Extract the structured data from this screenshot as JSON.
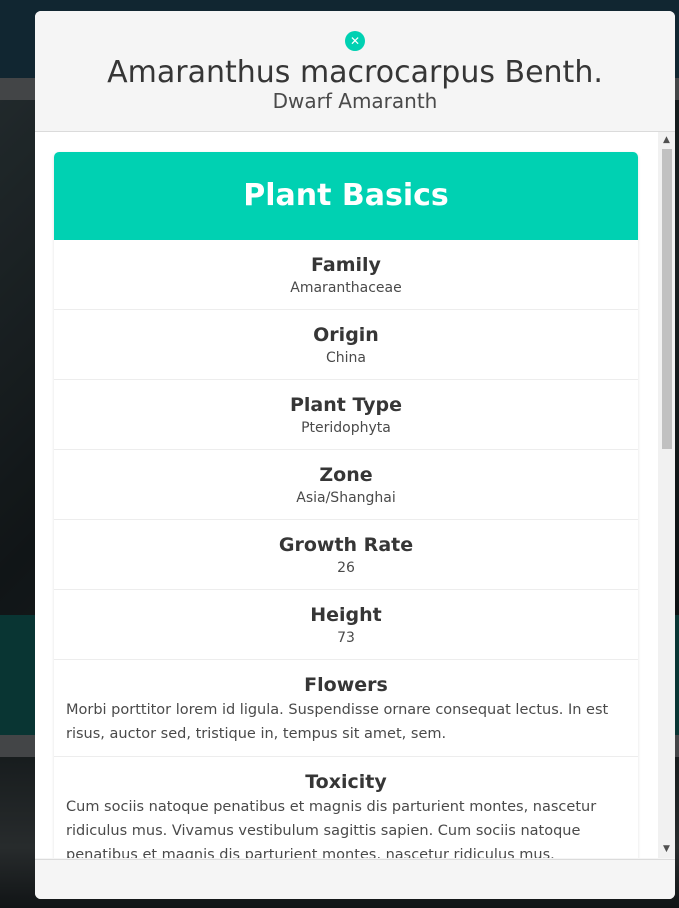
{
  "modal": {
    "close_icon": "close-icon",
    "title": "Amaranthus macrocarpus Benth.",
    "subtitle": "Dwarf Amaranth"
  },
  "card": {
    "header": "Plant Basics",
    "rows": [
      {
        "label": "Family",
        "value": "Amaranthaceae"
      },
      {
        "label": "Origin",
        "value": "China"
      },
      {
        "label": "Plant Type",
        "value": "Pteridophyta"
      },
      {
        "label": "Zone",
        "value": "Asia/Shanghai"
      },
      {
        "label": "Growth Rate",
        "value": "26"
      },
      {
        "label": "Height",
        "value": "73"
      },
      {
        "label": "Flowers",
        "value": "Morbi porttitor lorem id ligula. Suspendisse ornare consequat lectus. In est risus, auctor sed, tristique in, tempus sit amet, sem."
      },
      {
        "label": "Toxicity",
        "value": "Cum sociis natoque penatibus et magnis dis parturient montes, nascetur ridiculus mus. Vivamus vestibulum sagittis sapien. Cum sociis natoque penatibus et magnis dis parturient montes, nascetur ridiculus mus."
      }
    ]
  },
  "colors": {
    "accent": "#00d1b2",
    "modal_bg": "#f5f5f5",
    "text": "#363636"
  }
}
